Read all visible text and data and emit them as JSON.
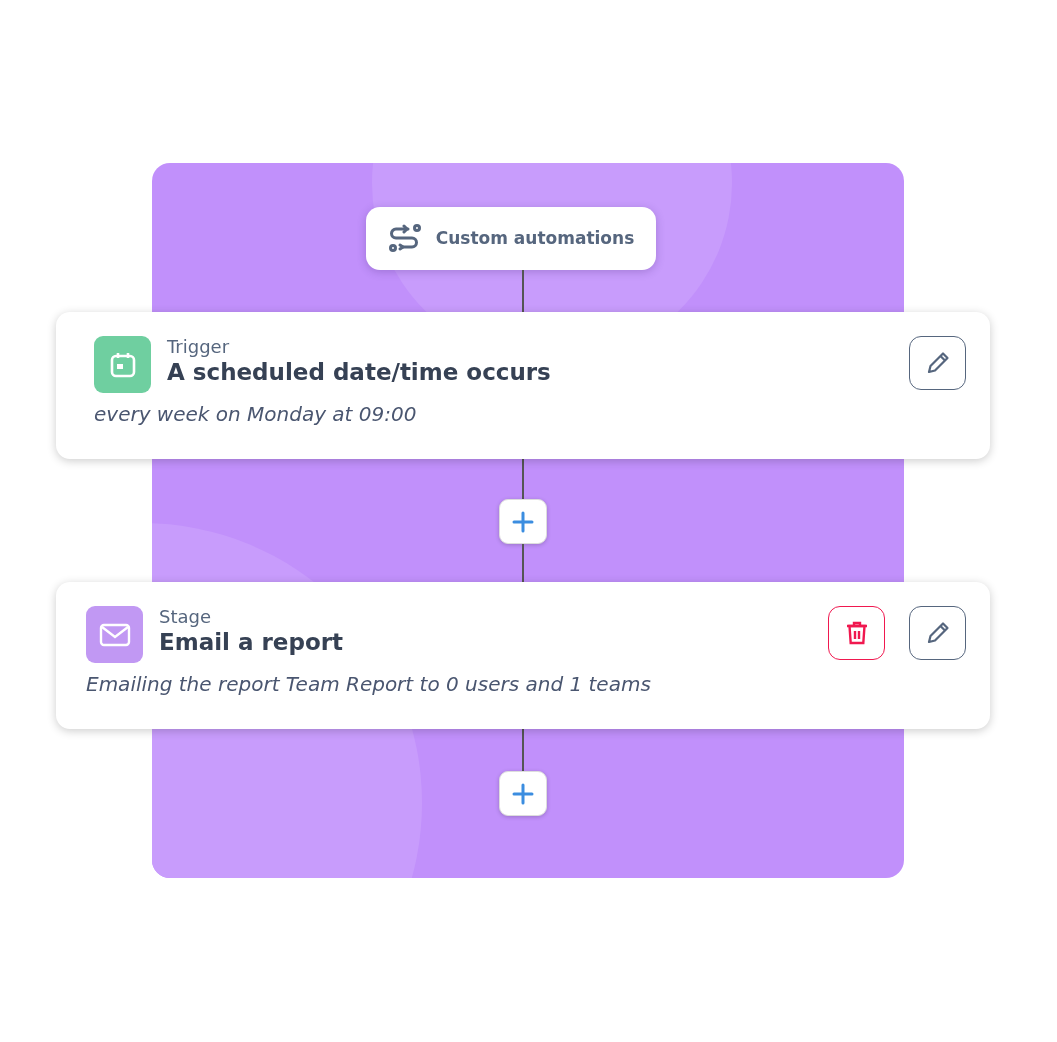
{
  "header": {
    "label": "Custom automations"
  },
  "steps": [
    {
      "kind": "trigger",
      "label": "Trigger",
      "title": "A scheduled date/time occurs",
      "description": "every week on Monday at 09:00",
      "deletable": false
    },
    {
      "kind": "stage",
      "label": "Stage",
      "title": "Email a report",
      "description": "Emailing the report Team Report to 0 users and 1 teams",
      "deletable": true
    }
  ]
}
